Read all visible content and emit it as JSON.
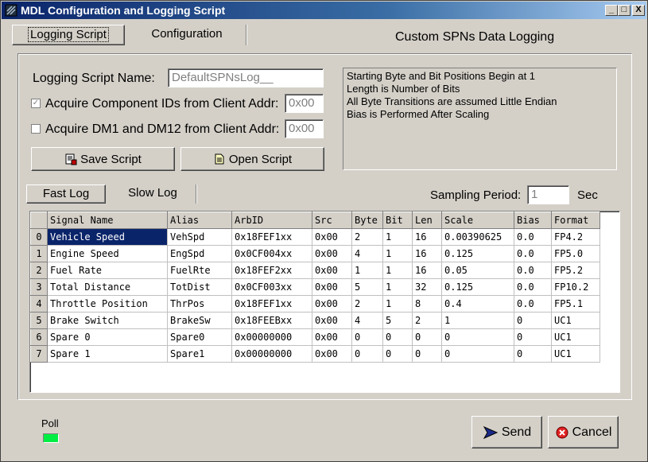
{
  "window": {
    "title": "MDL Configuration and Logging Script",
    "minimize": "_",
    "maximize": "□",
    "close": "X"
  },
  "tabs": [
    {
      "label": "Logging Script",
      "active": true
    },
    {
      "label": "Configuration",
      "active": false
    }
  ],
  "header_title": "Custom SPNs Data Logging",
  "script_form": {
    "name_label": "Logging Script Name:",
    "name_value": "DefaultSPNsLog__",
    "acquire_ids_label": "Acquire Component IDs from Client Addr:",
    "acquire_ids_checked": true,
    "acquire_ids_addr": "0x00",
    "acquire_dm_label": "Acquire DM1 and DM12 from Client Addr:",
    "acquire_dm_checked": false,
    "acquire_dm_addr": "0x00",
    "save_label": "Save Script",
    "open_label": "Open Script"
  },
  "notes": [
    "Starting Byte and Bit Positions Begin at 1",
    "Length is Number of Bits",
    "All Byte Transitions are assumed Little Endian",
    "Bias is Performed After Scaling"
  ],
  "log_tabs": [
    {
      "label": "Fast Log",
      "active": true
    },
    {
      "label": "Slow Log",
      "active": false
    }
  ],
  "sampling": {
    "label": "Sampling Period:",
    "value": "1",
    "unit": "Sec"
  },
  "table": {
    "columns": [
      "Signal Name",
      "Alias",
      "ArbID",
      "Src",
      "Byte",
      "Bit",
      "Len",
      "Scale",
      "Bias",
      "Format"
    ],
    "rows": [
      [
        "0",
        "Vehicle Speed",
        "VehSpd",
        "0x18FEF1xx",
        "0x00",
        "2",
        "1",
        "16",
        "0.00390625",
        "0.0",
        "FP4.2"
      ],
      [
        "1",
        "Engine Speed",
        "EngSpd",
        "0x0CF004xx",
        "0x00",
        "4",
        "1",
        "16",
        "0.125",
        "0.0",
        "FP5.0"
      ],
      [
        "2",
        "Fuel Rate",
        "FuelRte",
        "0x18FEF2xx",
        "0x00",
        "1",
        "1",
        "16",
        "0.05",
        "0.0",
        "FP5.2"
      ],
      [
        "3",
        "Total Distance",
        "TotDist",
        "0x0CF003xx",
        "0x00",
        "5",
        "1",
        "32",
        "0.125",
        "0.0",
        "FP10.2"
      ],
      [
        "4",
        "Throttle Position",
        "ThrPos",
        "0x18FEF1xx",
        "0x00",
        "2",
        "1",
        "8",
        "0.4",
        "0.0",
        "FP5.1"
      ],
      [
        "5",
        "Brake Switch",
        "BrakeSw",
        "0x18FEEBxx",
        "0x00",
        "4",
        "5",
        "2",
        "1",
        "0",
        "UC1"
      ],
      [
        "6",
        "Spare 0",
        "Spare0",
        "0x00000000",
        "0x00",
        "0",
        "0",
        "0",
        "0",
        "0",
        "UC1"
      ],
      [
        "7",
        "Spare 1",
        "Spare1",
        "0x00000000",
        "0x00",
        "0",
        "0",
        "0",
        "0",
        "0",
        "UC1"
      ]
    ]
  },
  "poll": {
    "label": "Poll",
    "color": "#00ee44"
  },
  "buttons": {
    "send": "Send",
    "cancel": "Cancel"
  }
}
